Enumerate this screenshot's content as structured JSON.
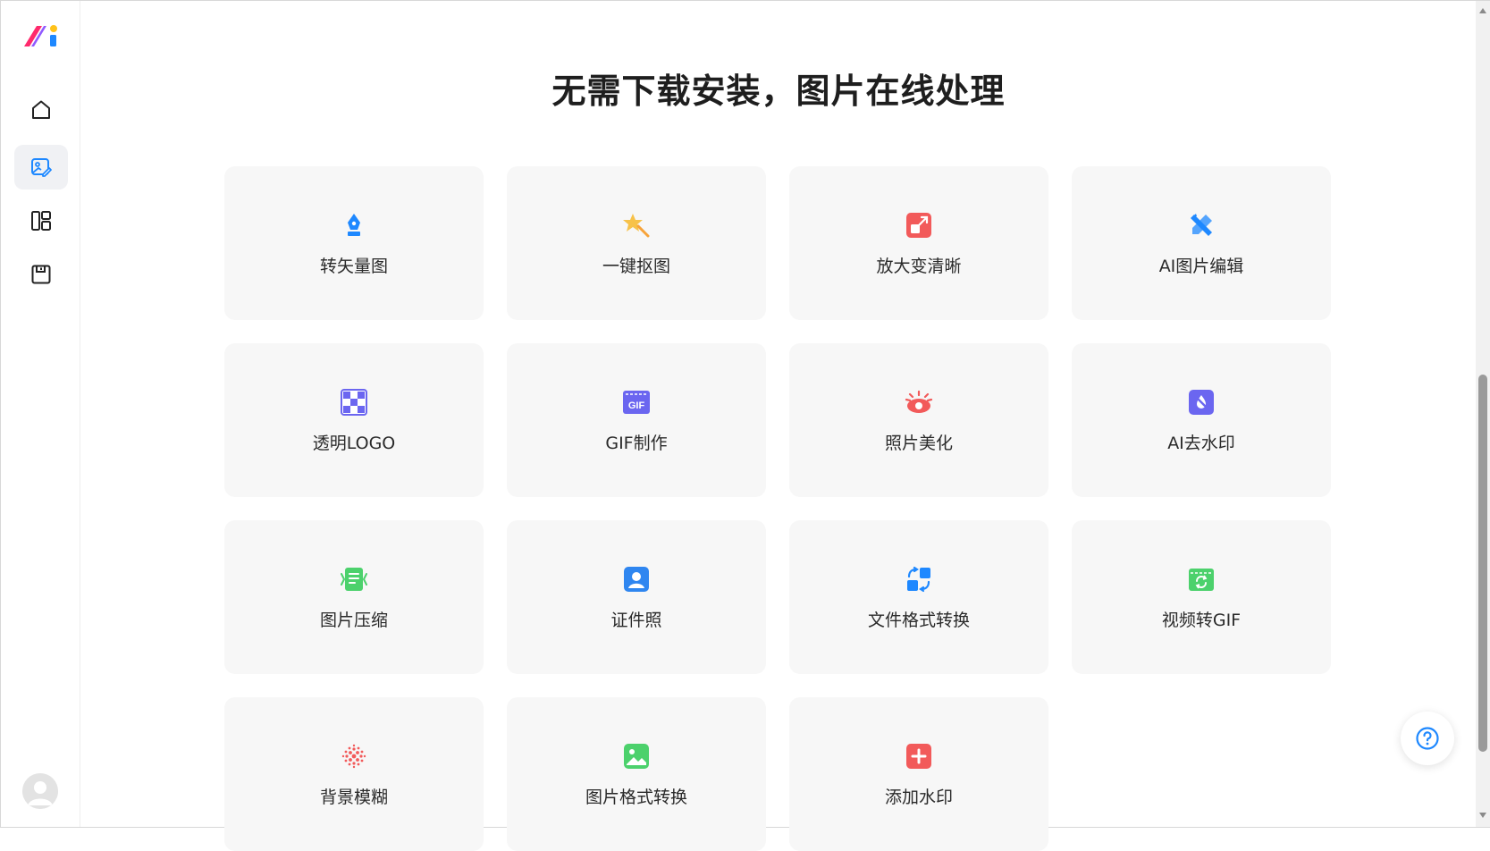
{
  "page": {
    "title": "无需下载安装，图片在线处理"
  },
  "sidebar": {
    "items": [
      {
        "name": "home",
        "icon": "home-icon",
        "active": false
      },
      {
        "name": "image-tools",
        "icon": "image-edit-icon",
        "active": true
      },
      {
        "name": "templates",
        "icon": "layout-icon",
        "active": false
      },
      {
        "name": "saved",
        "icon": "save-icon",
        "active": false
      }
    ]
  },
  "tools": [
    {
      "label": "转矢量图",
      "icon": "pen-nib-icon",
      "color": "#1e88ff"
    },
    {
      "label": "一键抠图",
      "icon": "magic-star-icon",
      "color": "#f7c24a"
    },
    {
      "label": "放大变清晰",
      "icon": "enlarge-icon",
      "color": "#f25a5a"
    },
    {
      "label": "AI图片编辑",
      "icon": "ai-edit-icon",
      "color": "#1e88ff"
    },
    {
      "label": "透明LOGO",
      "icon": "checker-icon",
      "color": "#6b66f0"
    },
    {
      "label": "GIF制作",
      "icon": "gif-icon",
      "color": "#6b66f0"
    },
    {
      "label": "照片美化",
      "icon": "eye-icon",
      "color": "#f25a5a"
    },
    {
      "label": "AI去水印",
      "icon": "drop-off-icon",
      "color": "#6b66f0"
    },
    {
      "label": "图片压缩",
      "icon": "compress-icon",
      "color": "#4cd16c"
    },
    {
      "label": "证件照",
      "icon": "id-photo-icon",
      "color": "#2f86f0"
    },
    {
      "label": "文件格式转换",
      "icon": "convert-icon",
      "color": "#1e88ff"
    },
    {
      "label": "视频转GIF",
      "icon": "video-gif-icon",
      "color": "#4cd16c"
    },
    {
      "label": "背景模糊",
      "icon": "blur-icon",
      "color": "#f25a5a"
    },
    {
      "label": "图片格式转换",
      "icon": "image-format-icon",
      "color": "#4cd16c"
    },
    {
      "label": "添加水印",
      "icon": "add-watermark-icon",
      "color": "#f25a5a"
    }
  ],
  "help": {
    "icon": "help-icon",
    "color": "#1e88ff"
  }
}
